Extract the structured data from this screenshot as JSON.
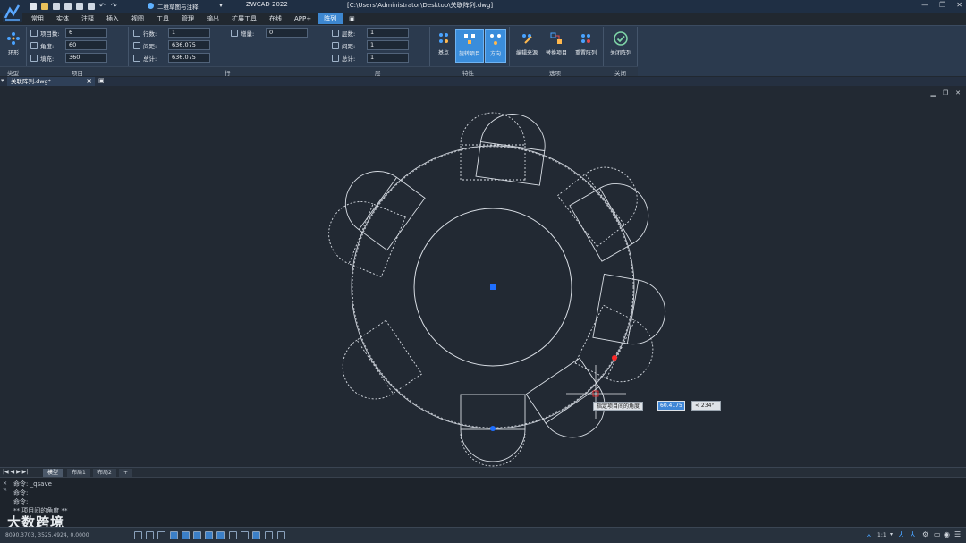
{
  "app": {
    "product": "ZWCAD 2022",
    "file_path": "[C:\\Users\\Administrator\\Desktop\\关联阵列.dwg]",
    "workspace": "二维草图与注释",
    "window_controls": [
      "—",
      "❐",
      "✕"
    ]
  },
  "menu": [
    "常用",
    "实体",
    "注释",
    "插入",
    "视图",
    "工具",
    "管理",
    "输出",
    "扩展工具",
    "在线",
    "APP+",
    "阵列"
  ],
  "menu_active": "阵列",
  "ribbon": {
    "type_button": "环形",
    "items": {
      "count_label": "项目数:",
      "count_value": "6",
      "angle_label": "角度:",
      "angle_value": "60",
      "fill_label": "填充:",
      "fill_value": "360"
    },
    "rows": {
      "rows_label": "行数:",
      "rows_value": "1",
      "spacing_label": "间距:",
      "spacing_value": "636.075",
      "total_label": "总计:",
      "total_value": "636.075",
      "incr_label": "增量:",
      "incr_value": "0"
    },
    "levels": {
      "levels_label": "层数:",
      "levels_value": "1",
      "spacing_label": "间距:",
      "spacing_value": "1",
      "total_label": "总计:",
      "total_value": "1"
    },
    "property_buttons": [
      "基点",
      "旋转项目",
      "方向"
    ],
    "option_buttons": [
      "编辑来源",
      "替换项目",
      "重置阵列"
    ],
    "close_button": "关闭阵列",
    "panel_labels": {
      "type": "类型",
      "items": "项目",
      "rows": "行",
      "levels": "层",
      "properties": "特性",
      "options": "选项",
      "close": "关闭"
    }
  },
  "doc_tab": "关联阵列.dwg*",
  "layout_tabs": [
    "模型",
    "布局1",
    "布局2",
    "+"
  ],
  "command": {
    "lines": [
      "命令: _qsave",
      "命令:",
      "命令:",
      "** 项目间的角度 **"
    ]
  },
  "status": {
    "coords": "8090.3703, 3525.4924, 0.0000",
    "annotation_scale": "1:1"
  },
  "dynamic_input": {
    "prompt": "指定项目间的角度",
    "value": "60.4175",
    "angle": "< 234°"
  },
  "watermark": "大数跨境",
  "colors": {
    "accent": "#3d87d0",
    "canvas": "#222933",
    "ribbon": "#2b3a4e",
    "grip_blue": "#1f6fff",
    "grip_red": "#ff2a2a"
  }
}
